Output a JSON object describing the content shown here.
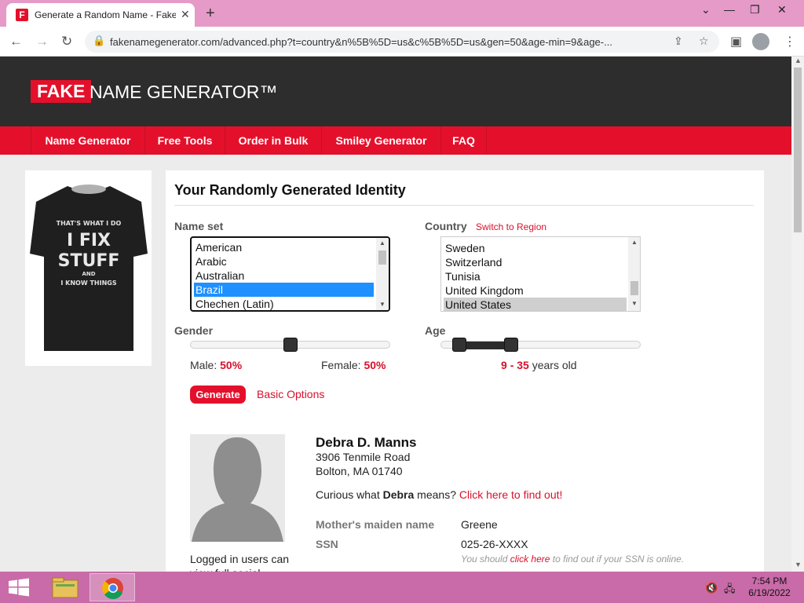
{
  "browser": {
    "tab_title": "Generate a Random Name - Fake",
    "favicon_letter": "F",
    "url": "fakenamegenerator.com/advanced.php?t=country&n%5B%5D=us&c%5B%5D=us&gen=50&age-min=9&age-..."
  },
  "site": {
    "logo_fake": "FAKE",
    "logo_rest": "NAME GENERATOR™",
    "nav": [
      "Name Generator",
      "Free Tools",
      "Order in Bulk",
      "Smiley Generator",
      "FAQ"
    ]
  },
  "shirt": {
    "line1": "THAT'S WHAT I DO",
    "line2": "I FIX",
    "line3": "STUFF",
    "line4": "AND",
    "line5": "I KNOW THINGS"
  },
  "form": {
    "title": "Your Randomly Generated Identity",
    "name_set_label": "Name set",
    "name_set_options": [
      "American",
      "Arabic",
      "Australian",
      "Brazil",
      "Chechen (Latin)"
    ],
    "name_set_selected": "Brazil",
    "country_label": "Country",
    "switch_region": "Switch to Region",
    "country_options": [
      "Sweden",
      "Switzerland",
      "Tunisia",
      "United Kingdom",
      "United States"
    ],
    "country_selected": "United States",
    "gender_label": "Gender",
    "gender_male_label": "Male:",
    "gender_male_pct": "50%",
    "gender_female_label": "Female:",
    "gender_female_pct": "50%",
    "gender_male_fraction": 0.5,
    "age_label": "Age",
    "age_min": "9",
    "age_dash": "-",
    "age_max": "35",
    "age_suffix": "years old",
    "generate_label": "Generate",
    "basic_options_label": "Basic Options"
  },
  "identity": {
    "name": "Debra D. Manns",
    "address_line1": "3906 Tenmile Road",
    "address_line2": "Bolton, MA 01740",
    "curious_pre": "Curious what",
    "curious_name": "Debra",
    "curious_mid": "means?",
    "curious_link": "Click here to find out!",
    "maiden_label": "Mother's maiden name",
    "maiden_value": "Greene",
    "ssn_label": "SSN",
    "ssn_value": "025-26-XXXX",
    "ssn_note_pre": "You should",
    "ssn_note_link": "click here",
    "ssn_note_post": "to find out if your SSN is online.",
    "logged_note": "Logged in users can view full social"
  },
  "taskbar": {
    "time": "7:54 PM",
    "date": "6/19/2022"
  },
  "colors": {
    "brand_red": "#e4102b",
    "header_dark": "#2d2d2d",
    "taskbar": "#c96ba8"
  }
}
